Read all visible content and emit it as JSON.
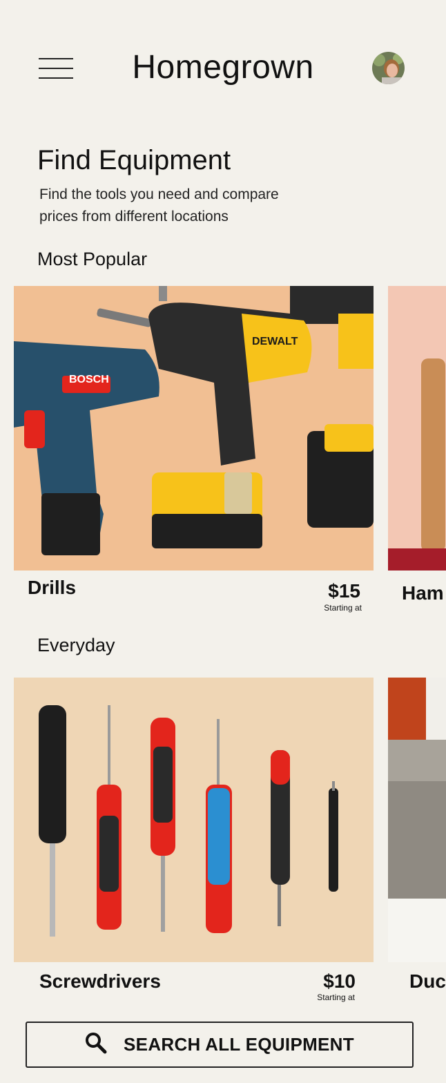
{
  "header": {
    "app_title": "Homegrown",
    "menu_icon": "hamburger-menu-icon",
    "avatar": "user-avatar"
  },
  "intro": {
    "title": "Find Equipment",
    "subtitle_line1": "Find the tools you need and compare",
    "subtitle_line2": "prices from different locations"
  },
  "sections": [
    {
      "title": "Most Popular",
      "cards": [
        {
          "name": "Drills",
          "price": "$15",
          "price_note": "Starting at",
          "image": "drills-photo"
        },
        {
          "name": "Ham",
          "image": "hammer-photo"
        }
      ]
    },
    {
      "title": "Everyday",
      "cards": [
        {
          "name": "Screwdrivers",
          "price": "$10",
          "price_note": "Starting at",
          "image": "screwdrivers-photo"
        },
        {
          "name": "Duc",
          "image": "duct-tape-photo"
        }
      ]
    }
  ],
  "search_button": {
    "label": "SEARCH ALL EQUIPMENT",
    "icon": "search-icon"
  },
  "colors": {
    "background": "#f3f1eb",
    "text": "#111111",
    "drill_bg": "#f1bf93",
    "screwdriver_bg": "#efd6b5",
    "accent_red": "#e3251c",
    "accent_yellow": "#f7c21a"
  }
}
